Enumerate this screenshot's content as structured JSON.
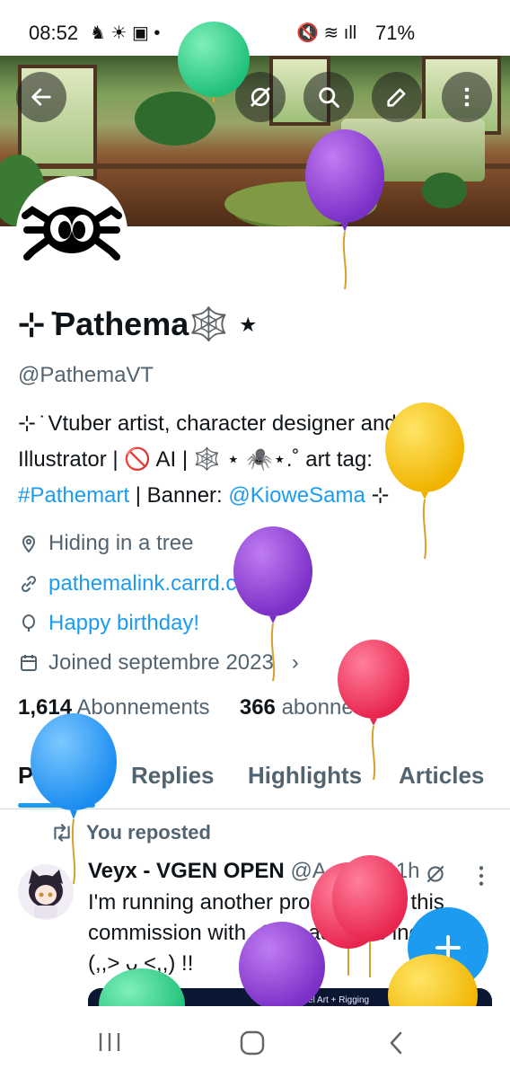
{
  "status_bar": {
    "time": "08:52",
    "battery": "71%"
  },
  "header": {
    "back_icon": "arrow-left-icon",
    "grok_icon": "grok-icon",
    "search_icon": "search-icon",
    "edit_icon": "edit-icon",
    "more_icon": "more-vertical-icon"
  },
  "profile": {
    "display_name": "⊹ ̇Pathema🕸️ ⋆",
    "handle": "@PathemaVT",
    "bio_line1": "⊹ ̇ Vtuber artist, character designer and",
    "bio_line2": "Illustrator | 🚫 AI | 🕸️ ⋆ 🕷️⋆.˚ art tag:",
    "bio_hashtag": "#Pathemart",
    "bio_banner_text": " | Banner: ",
    "bio_banner_link": "@KioweSama",
    "bio_tail": " ⊹",
    "location": "Hiding in a tree",
    "website": "pathemalink.carrd.co",
    "birthday": "Happy birthday!",
    "joined": "Joined septembre 2023",
    "following_count": "1,614",
    "following_label": "Abonnements",
    "followers_count": "366",
    "followers_label": "abonnés"
  },
  "tabs": [
    "Posts",
    "Replies",
    "Highlights",
    "Articles"
  ],
  "post": {
    "context": "You reposted",
    "author": "Veyx - VGEN OPEN",
    "author_handle": "@A",
    "time": "11h",
    "text": "I'm running another promotion on this commission with -15% add-ons included (,,> ᴗ <,,) !!",
    "media_caption": "Chibi Model Art + Rigging"
  },
  "colors": {
    "accent": "#1d9bf0",
    "text": "#0f1419",
    "muted": "#536471"
  }
}
